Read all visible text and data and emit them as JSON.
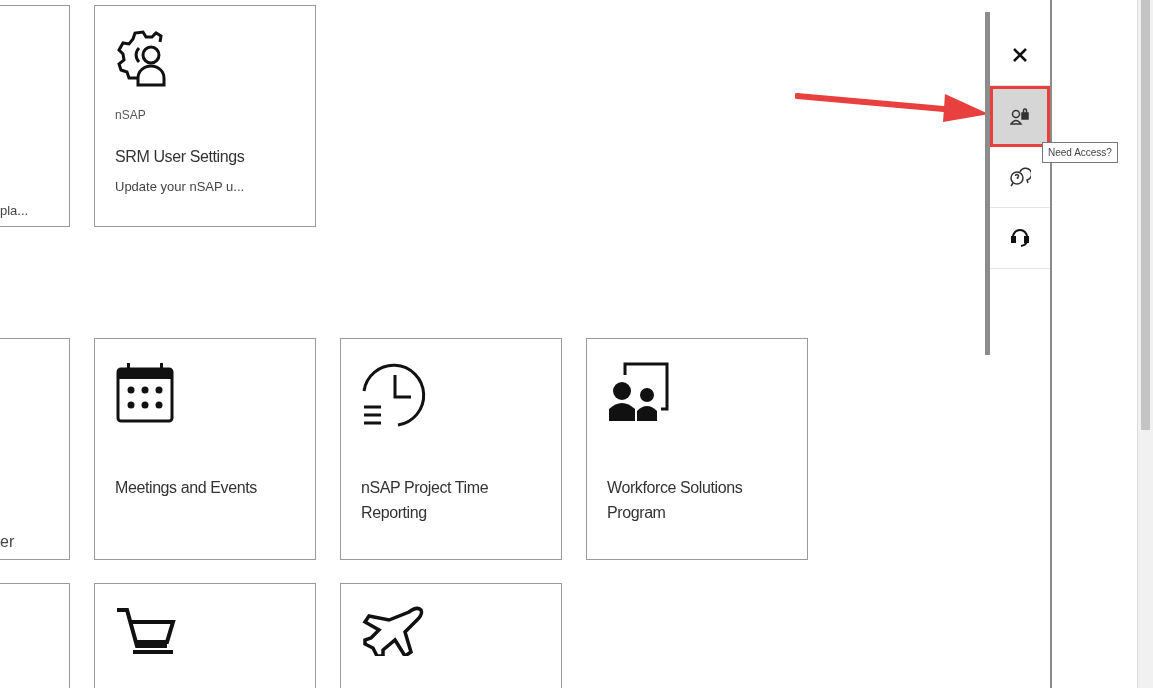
{
  "sections": [
    {
      "rows": [
        {
          "partial_text": "pla...",
          "tiles": [
            {
              "kind": "gear-person",
              "subtitle": "nSAP",
              "title": "SRM User Settings",
              "description": "Update your nSAP u..."
            }
          ]
        }
      ]
    },
    {
      "rows": [
        {
          "partial_text": "er",
          "tiles": [
            {
              "kind": "calendar",
              "title": "Meetings and Events"
            },
            {
              "kind": "clock",
              "title": "nSAP Project Time Reporting"
            },
            {
              "kind": "presentation",
              "title": "Workforce Solutions Program"
            }
          ]
        },
        {
          "tiles": [
            {
              "kind": "cart"
            },
            {
              "kind": "plane"
            }
          ]
        }
      ]
    }
  ],
  "side_panel": {
    "buttons": [
      {
        "kind": "close",
        "selected": false
      },
      {
        "kind": "access",
        "selected": true,
        "tooltip": "Need Access?"
      },
      {
        "kind": "chat",
        "selected": false
      },
      {
        "kind": "headset",
        "selected": false
      }
    ]
  }
}
